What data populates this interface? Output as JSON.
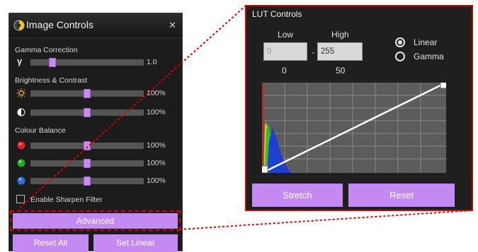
{
  "image_controls": {
    "title": "Image Controls",
    "close_glyph": "✕",
    "gamma": {
      "label": "Gamma Correction",
      "symbol": "γ",
      "value": "1.0",
      "level": 0.18
    },
    "brightness_contrast": {
      "label": "Brightness & Contrast",
      "brightness": {
        "icon": "sun-icon",
        "value": "100%",
        "level": 0.5
      },
      "contrast": {
        "icon": "half-circle-icon",
        "value": "100%",
        "level": 0.5
      }
    },
    "colour_balance": {
      "label": "Colour Balance",
      "red": {
        "icon": "red-dot-icon",
        "color": "#e02020",
        "value": "100%",
        "level": 0.5
      },
      "green": {
        "icon": "green-dot-icon",
        "color": "#20b020",
        "value": "100%",
        "level": 0.5
      },
      "blue": {
        "icon": "blue-dot-icon",
        "color": "#2a70d8",
        "value": "100%",
        "level": 0.5
      }
    },
    "sharpen": {
      "label": "Enable Sharpen Filter",
      "checked": false
    },
    "buttons": {
      "advanced": "Advanced",
      "reset_all": "Reset All",
      "set_linear": "Set Linear"
    }
  },
  "lut_controls": {
    "title": "LUT Controls",
    "low": {
      "label": "Low",
      "value": "0",
      "under": "0"
    },
    "high": {
      "label": "High",
      "value": "255",
      "under": "50"
    },
    "separator": "-",
    "modes": [
      {
        "label": "Linear",
        "selected": true
      },
      {
        "label": "Gamma",
        "selected": false
      }
    ],
    "buttons": {
      "stretch": "Stretch",
      "reset": "Reset"
    }
  },
  "colors": {
    "accent": "#c48af2",
    "highlight_outline": "#e00000",
    "panel_bg": "#1c1c1c"
  }
}
